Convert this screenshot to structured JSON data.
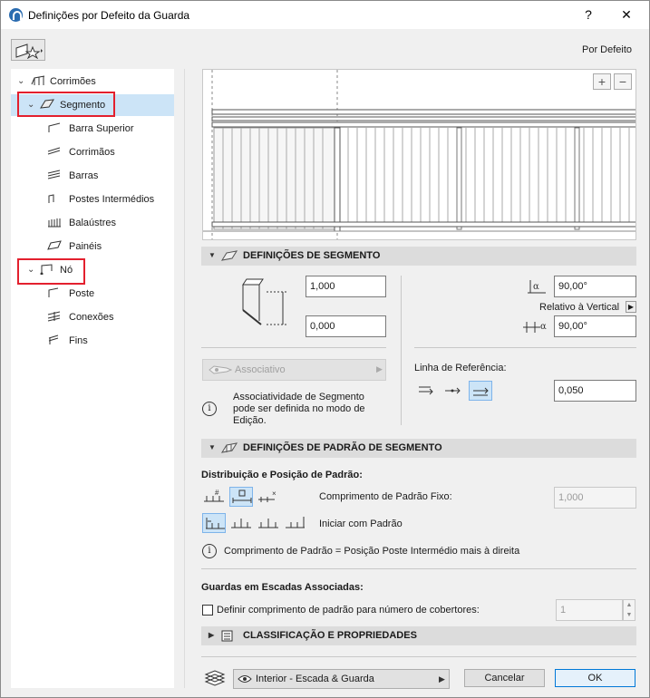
{
  "window": {
    "title": "Definições por Defeito da Guarda",
    "help_label": "?",
    "close_label": "✕"
  },
  "header": {
    "default_label": "Por Defeito"
  },
  "tree": {
    "items": [
      {
        "label": "Corrimões"
      },
      {
        "label": "Segmento"
      },
      {
        "label": "Barra Superior"
      },
      {
        "label": "Corrimãos"
      },
      {
        "label": "Barras"
      },
      {
        "label": "Postes Intermédios"
      },
      {
        "label": "Balaústres"
      },
      {
        "label": "Painéis"
      },
      {
        "label": "Nó"
      },
      {
        "label": "Poste"
      },
      {
        "label": "Conexões"
      },
      {
        "label": "Fins"
      }
    ]
  },
  "preview": {
    "zoom_in": "+",
    "zoom_out": "−"
  },
  "segment_settings": {
    "title": "DEFINIÇÕES DE SEGMENTO",
    "height_value": "1,000",
    "offset_value": "0,000",
    "angle_value": "90,00°",
    "relative_label": "Relativo à Vertical",
    "slope_value": "90,00°",
    "associative_label": "Associativo",
    "info_text_1": "Associatividade de Segmento",
    "info_text_2": "pode ser definida no modo de",
    "info_text_3": "Edição.",
    "reference_line_label": "Linha de Referência:",
    "reference_value": "0,050"
  },
  "pattern_settings": {
    "title": "DEFINIÇÕES DE PADRÃO DE SEGMENTO",
    "distribution_label": "Distribuição e Posição de Padrão:",
    "fixed_length_label": "Comprimento de Padrão Fixo:",
    "fixed_length_value": "1,000",
    "start_label": "Iniciar com Padrão",
    "info_text": "Comprimento de Padrão = Posição Poste Intermédio mais à direita"
  },
  "stairs": {
    "title": "Guardas em Escadas Associadas:",
    "checkbox_label": "Definir comprimento de padrão para número de cobertores:",
    "count_value": "1"
  },
  "classification": {
    "title": "CLASSIFICAÇÃO E PROPRIEDADES"
  },
  "footer": {
    "layer_label": "Interior - Escada & Guarda",
    "cancel_label": "Cancelar",
    "ok_label": "OK"
  }
}
